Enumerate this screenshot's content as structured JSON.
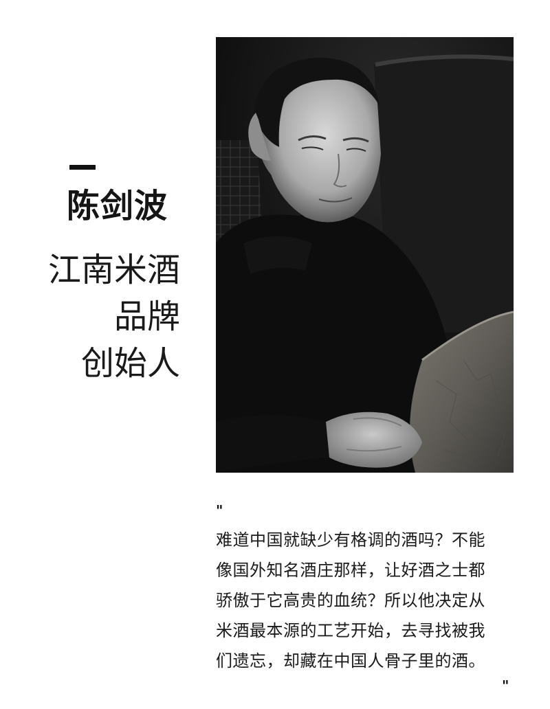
{
  "profile": {
    "name": "陈剑波",
    "title_lines": [
      "江南米酒",
      "品牌",
      "创始人"
    ]
  },
  "portrait": {
    "icon": "founder-portrait",
    "tone": "black-and-white"
  },
  "quote": {
    "open_mark": "\"",
    "close_mark": "\"",
    "lines": [
      "难道中国就缺少有格调的酒吗？不能",
      "像国外知名酒庄那样，让好酒之士都",
      "骄傲于它高贵的血统？所以他决定从",
      "米酒最本源的工艺开始，去寻找被我",
      "们遗忘，却藏在中国人骨子里的酒。"
    ]
  }
}
